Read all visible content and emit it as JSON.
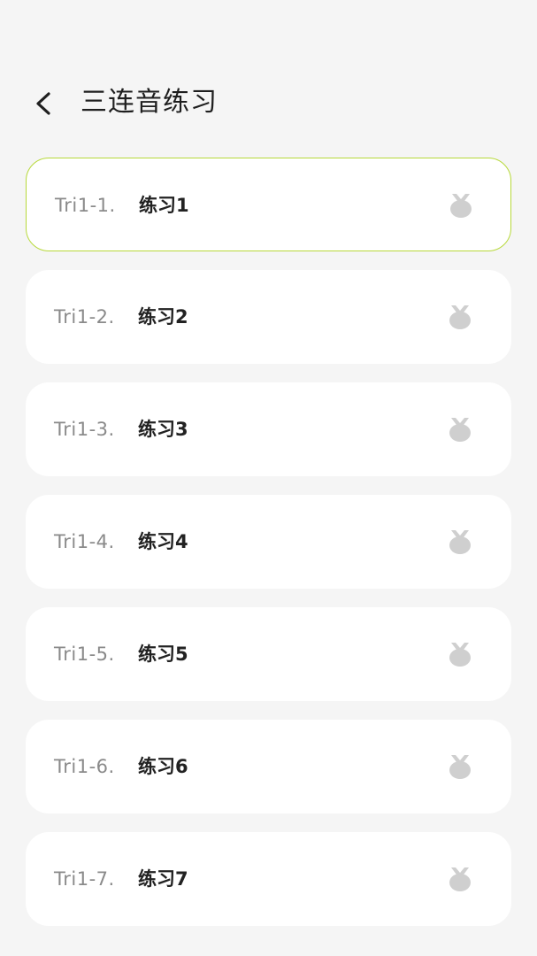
{
  "header": {
    "back_icon": "chevron-left-icon",
    "title": "三连音练习"
  },
  "items": [
    {
      "code": "Tri1-1.",
      "name": "练习1",
      "icon": "medal-icon",
      "selected": true
    },
    {
      "code": "Tri1-2.",
      "name": "练习2",
      "icon": "medal-icon",
      "selected": false
    },
    {
      "code": "Tri1-3.",
      "name": "练习3",
      "icon": "medal-icon",
      "selected": false
    },
    {
      "code": "Tri1-4.",
      "name": "练习4",
      "icon": "medal-icon",
      "selected": false
    },
    {
      "code": "Tri1-5.",
      "name": "练习5",
      "icon": "medal-icon",
      "selected": false
    },
    {
      "code": "Tri1-6.",
      "name": "练习6",
      "icon": "medal-icon",
      "selected": false
    },
    {
      "code": "Tri1-7.",
      "name": "练习7",
      "icon": "medal-icon",
      "selected": false
    }
  ],
  "colors": {
    "background": "#f5f5f5",
    "card": "#ffffff",
    "selected_border": "#b7d93a",
    "medal": "#cfcfcf",
    "code_text": "#8a8a8a",
    "name_text": "#222222"
  }
}
